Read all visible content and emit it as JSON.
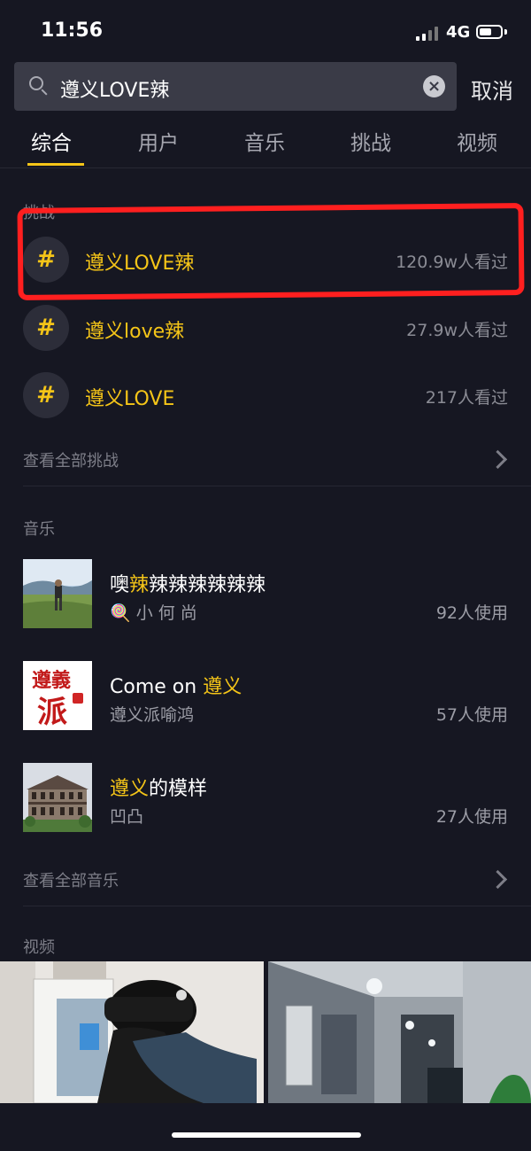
{
  "status": {
    "time": "11:56",
    "network": "4G",
    "battery_level": 0.6
  },
  "search": {
    "query": "遵义LOVE辣",
    "cancel_label": "取消"
  },
  "tabs": [
    {
      "label": "综合",
      "active": true
    },
    {
      "label": "用户",
      "active": false
    },
    {
      "label": "音乐",
      "active": false
    },
    {
      "label": "挑战",
      "active": false
    },
    {
      "label": "视频",
      "active": false
    }
  ],
  "challenges": {
    "section_title": "挑战",
    "items": [
      {
        "icon": "#",
        "name": "遵义LOVE辣",
        "views": "120.9w人看过"
      },
      {
        "icon": "#",
        "name": "遵义love辣",
        "views": "27.9w人看过"
      },
      {
        "icon": "#",
        "name": "遵义LOVE",
        "views": "217人看过"
      }
    ],
    "see_all": "查看全部挑战"
  },
  "music": {
    "section_title": "音乐",
    "items": [
      {
        "title_hl": "",
        "title_pre": "噢",
        "title_mid": "辣",
        "title_post": "辣辣辣辣辣辣",
        "artist": "🍭 小 何 尚",
        "uses": "92人使用"
      },
      {
        "title_pre": "Come on ",
        "title_mid": "遵义",
        "title_post": "",
        "artist": "遵义派喻鸿",
        "uses": "57人使用",
        "cover_text_top": "遵義",
        "cover_text_bottom": "派"
      },
      {
        "title_pre": "",
        "title_mid": "遵义",
        "title_post": "的模样",
        "artist": "凹凸",
        "uses": "27人使用"
      }
    ],
    "see_all": "查看全部音乐"
  },
  "videos": {
    "section_title": "视频"
  },
  "colors": {
    "accent": "#f5c518",
    "background": "#161722",
    "highlight": "#ff1f1f"
  }
}
